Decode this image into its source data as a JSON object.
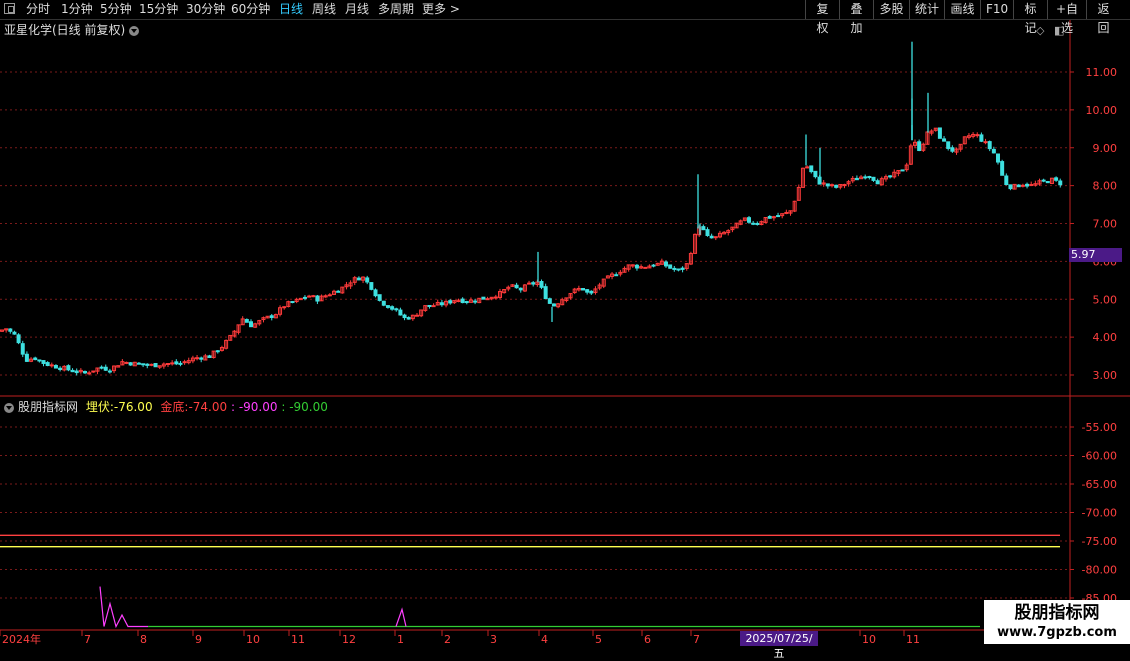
{
  "toolbar": {
    "periods": [
      "分时",
      "1分钟",
      "5分钟",
      "15分钟",
      "30分钟",
      "60分钟",
      "日线",
      "周线",
      "月线",
      "多周期",
      "更多 >"
    ],
    "active_period": "日线",
    "right_buttons": [
      "复权",
      "叠加",
      "多股",
      "统计",
      "画线",
      "F10",
      "标记",
      "+自选",
      "返回"
    ]
  },
  "chart_title": "亚星化学(日线 前复权)",
  "current_price_tag": "5.97",
  "indicator": {
    "name": "股朋指标网",
    "line1_label": "埋伏:",
    "line1_value": "-76.00",
    "line2_label": "金底:",
    "line2_value": "-74.00",
    "line3": ": -90.00",
    "line4": ": -90.00"
  },
  "watermark": {
    "line1": "股朋指标网",
    "line2": "www.7gpzb.com"
  },
  "date_tag": "2025/07/25/五",
  "colors": {
    "up": "#ff3b3b",
    "down": "#3ee0e0",
    "grid": "#7a1a1a",
    "axis": "#c02020",
    "yellow": "#ffff50",
    "magenta": "#ff40ff",
    "green": "#33cc33",
    "purple_tag": "#4b1a87"
  },
  "chart_data": {
    "type": "candlestick",
    "price_axis": {
      "ticks": [
        "11.00",
        "10.00",
        "9.00",
        "8.00",
        "7.00",
        "6.00",
        "5.00",
        "4.00",
        "3.00"
      ],
      "ylim": [
        2.55,
        11.95
      ]
    },
    "indicator_axis": {
      "ticks": [
        "-55.00",
        "-60.00",
        "-65.00",
        "-70.00",
        "-75.00",
        "-80.00",
        "-85.00"
      ],
      "ylim": [
        -92,
        -51
      ]
    },
    "x_axis_labels": [
      "2024年",
      "7",
      "8",
      "9",
      "10",
      "11",
      "12",
      "1",
      "2",
      "3",
      "4",
      "5",
      "6",
      "7",
      "8",
      "10",
      "11"
    ],
    "close_path": [
      [
        0,
        4.15
      ],
      [
        5,
        4.25
      ],
      [
        15,
        4.05
      ],
      [
        20,
        3.75
      ],
      [
        26,
        3.4
      ],
      [
        35,
        3.45
      ],
      [
        45,
        3.3
      ],
      [
        60,
        3.2
      ],
      [
        75,
        3.1
      ],
      [
        85,
        3.05
      ],
      [
        100,
        3.2
      ],
      [
        110,
        3.15
      ],
      [
        122,
        3.35
      ],
      [
        135,
        3.3
      ],
      [
        150,
        3.25
      ],
      [
        165,
        3.3
      ],
      [
        180,
        3.3
      ],
      [
        195,
        3.45
      ],
      [
        210,
        3.5
      ],
      [
        222,
        3.75
      ],
      [
        232,
        4.05
      ],
      [
        242,
        4.5
      ],
      [
        252,
        4.3
      ],
      [
        262,
        4.45
      ],
      [
        275,
        4.6
      ],
      [
        285,
        4.85
      ],
      [
        296,
        4.95
      ],
      [
        308,
        5.1
      ],
      [
        318,
        5.0
      ],
      [
        330,
        5.15
      ],
      [
        342,
        5.3
      ],
      [
        352,
        5.5
      ],
      [
        362,
        5.6
      ],
      [
        372,
        5.3
      ],
      [
        380,
        4.95
      ],
      [
        390,
        4.8
      ],
      [
        398,
        4.65
      ],
      [
        404,
        4.5
      ],
      [
        414,
        4.55
      ],
      [
        424,
        4.8
      ],
      [
        436,
        4.85
      ],
      [
        446,
        4.9
      ],
      [
        456,
        5.0
      ],
      [
        468,
        4.95
      ],
      [
        478,
        5.0
      ],
      [
        488,
        5.05
      ],
      [
        500,
        5.15
      ],
      [
        510,
        5.35
      ],
      [
        520,
        5.25
      ],
      [
        530,
        5.4
      ],
      [
        538,
        5.45
      ],
      [
        545,
        5.1
      ],
      [
        552,
        4.8
      ],
      [
        562,
        5.0
      ],
      [
        572,
        5.2
      ],
      [
        582,
        5.3
      ],
      [
        590,
        5.1
      ],
      [
        600,
        5.4
      ],
      [
        610,
        5.6
      ],
      [
        620,
        5.75
      ],
      [
        630,
        5.9
      ],
      [
        642,
        5.85
      ],
      [
        652,
        5.9
      ],
      [
        662,
        5.95
      ],
      [
        672,
        5.8
      ],
      [
        680,
        5.75
      ],
      [
        688,
        5.95
      ],
      [
        694,
        6.6
      ],
      [
        700,
        7.0
      ],
      [
        706,
        6.65
      ],
      [
        714,
        6.6
      ],
      [
        724,
        6.75
      ],
      [
        734,
        6.9
      ],
      [
        744,
        7.1
      ],
      [
        756,
        7.0
      ],
      [
        766,
        7.15
      ],
      [
        778,
        7.2
      ],
      [
        790,
        7.3
      ],
      [
        798,
        7.85
      ],
      [
        804,
        8.6
      ],
      [
        810,
        8.4
      ],
      [
        818,
        8.1
      ],
      [
        828,
        8.0
      ],
      [
        838,
        7.95
      ],
      [
        848,
        8.1
      ],
      [
        858,
        8.2
      ],
      [
        868,
        8.3
      ],
      [
        878,
        8.1
      ],
      [
        888,
        8.2
      ],
      [
        898,
        8.35
      ],
      [
        906,
        8.5
      ],
      [
        912,
        9.2
      ],
      [
        920,
        8.95
      ],
      [
        928,
        9.4
      ],
      [
        935,
        9.5
      ],
      [
        942,
        9.2
      ],
      [
        950,
        8.95
      ],
      [
        958,
        8.9
      ],
      [
        966,
        9.3
      ],
      [
        976,
        9.35
      ],
      [
        986,
        9.1
      ],
      [
        996,
        8.8
      ],
      [
        1004,
        8.1
      ],
      [
        1012,
        7.95
      ],
      [
        1022,
        8.05
      ],
      [
        1032,
        8.0
      ],
      [
        1042,
        8.1
      ],
      [
        1052,
        8.15
      ],
      [
        1062,
        8.05
      ]
    ],
    "spikes": [
      [
        538,
        6.25
      ],
      [
        552,
        4.4
      ],
      [
        698,
        8.3
      ],
      [
        700,
        6.7
      ],
      [
        806,
        9.35
      ],
      [
        820,
        9.0
      ],
      [
        912,
        11.8
      ],
      [
        912,
        10.3
      ],
      [
        928,
        10.45
      ],
      [
        912,
        9.6
      ]
    ]
  }
}
